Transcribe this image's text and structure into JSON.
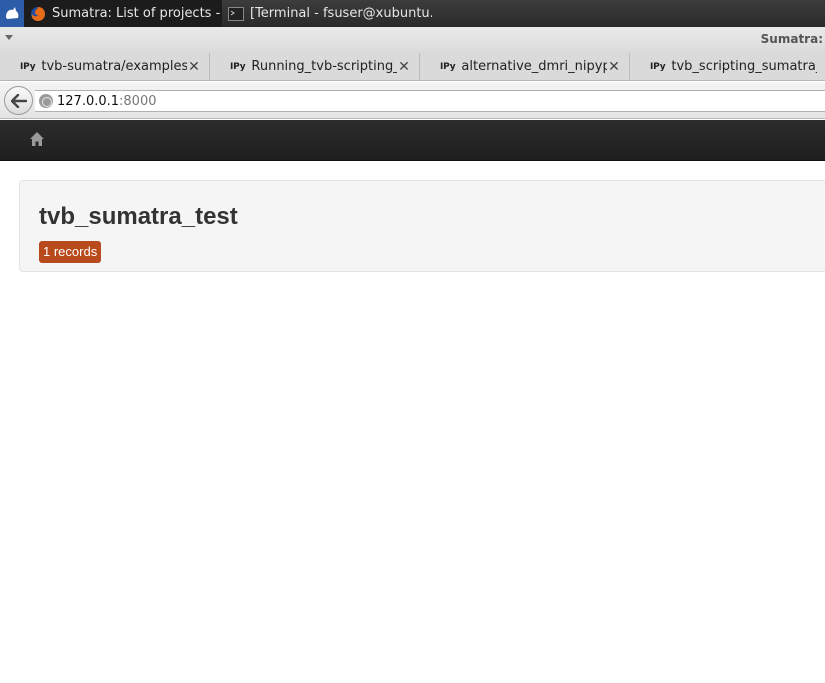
{
  "taskbar": {
    "tasks": [
      {
        "label": "Sumatra: List of projects - ...",
        "icon": "firefox-icon"
      },
      {
        "label": "[Terminal - fsuser@xubuntu...",
        "icon": "terminal-icon"
      }
    ]
  },
  "browser": {
    "window_title": "Sumatra:",
    "tabs": [
      {
        "badge": "IPy",
        "label": "tvb-sumatra/examples/..."
      },
      {
        "badge": "IPy",
        "label": "Running_tvb-scripting_..."
      },
      {
        "badge": "IPy",
        "label": "alternative_dmri_nipyp..."
      },
      {
        "badge": "IPy",
        "label": "tvb_scripting_sumatra_..."
      }
    ],
    "url": {
      "host": "127.0.0.1",
      "port": ":8000"
    }
  },
  "page": {
    "nav": {
      "home_icon": "home-icon"
    },
    "project": {
      "name": "tvb_sumatra_test",
      "records_badge": "1 records"
    }
  },
  "colors": {
    "navbar": "#222222",
    "badge": "#b94a1c",
    "card": "#f5f5f5"
  }
}
